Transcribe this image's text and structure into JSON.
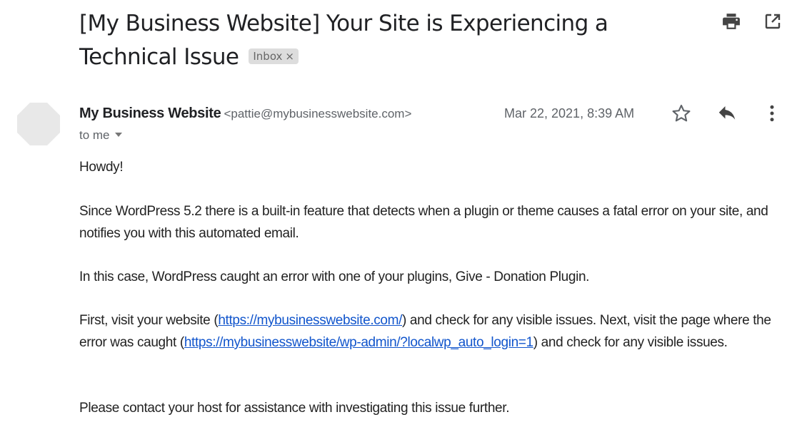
{
  "subject": {
    "title": "[My Business Website] Your Site is Experiencing a Technical Issue",
    "label_badge": "Inbox",
    "label_remove": "×"
  },
  "toolbar": {
    "icons": [
      "print-icon",
      "open-in-new-window-icon"
    ]
  },
  "message": {
    "sender_name": "My Business Website",
    "sender_email": "<pattie@mybusinesswebsite.com>",
    "recipient_label": "to me",
    "date": "Mar 22, 2021, 8:39 AM",
    "action_icons": [
      "star-icon",
      "reply-icon",
      "more-options-icon"
    ]
  },
  "body": {
    "greeting": "Howdy!",
    "para1": "Since WordPress 5.2 there is a built-in feature that detects when a plugin or theme causes a fatal error on your site, and notifies you with this automated email.",
    "para2": "In this case, WordPress caught an error with one of your plugins, Give - Donation Plugin.",
    "para3": {
      "t1": "First, visit your website (",
      "link1": "https://mybusinesswebsite.com/",
      "t2": ") and check for any visible issues. Next, visit the page where the error was caught (",
      "link2": "https://mybusinesswebsite/wp-admin/?localwp_auto_login=1",
      "t3": ") and check for any visible issues."
    },
    "para4": "Please contact your host for assistance with investigating this issue further."
  }
}
